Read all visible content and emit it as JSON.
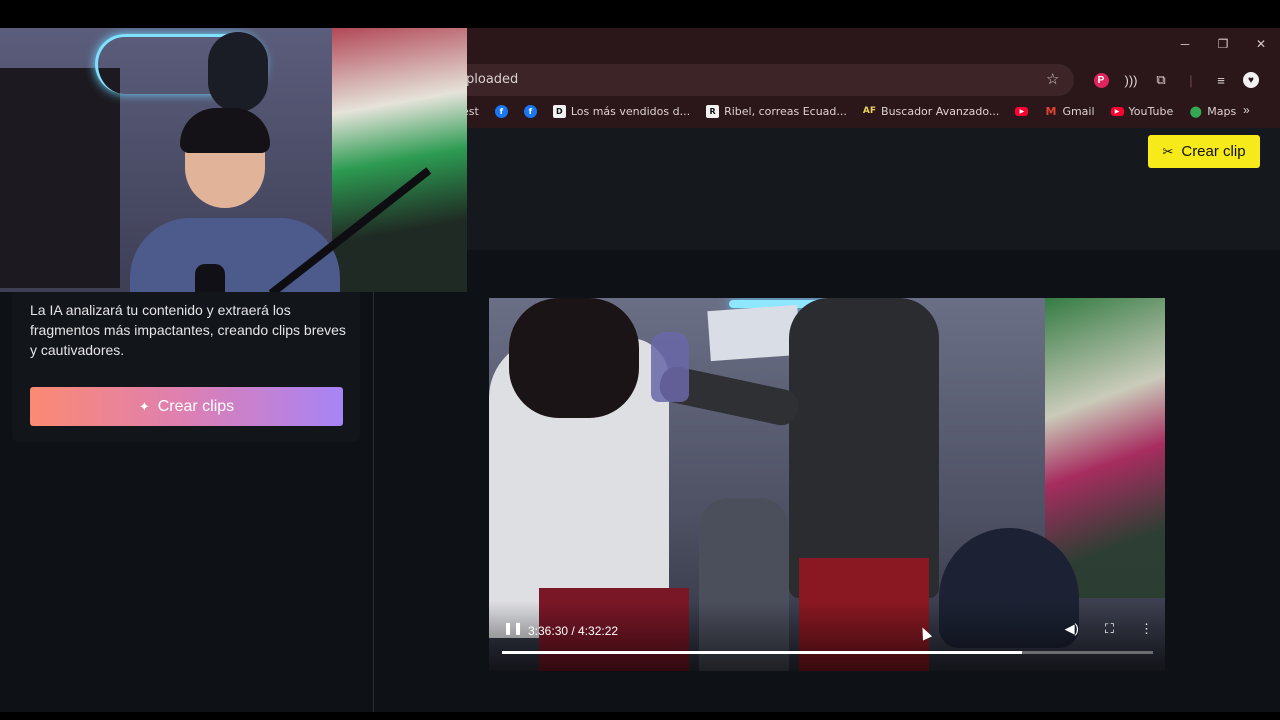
{
  "browser": {
    "url_text": "ploaded",
    "window_controls": [
      "─",
      "❐",
      "✕"
    ],
    "bookmarks": [
      {
        "label": "est",
        "icon": "none"
      },
      {
        "label": "",
        "icon": "facebook-icon"
      },
      {
        "label": "",
        "icon": "facebook-icon"
      },
      {
        "label": "Los más vendidos d...",
        "icon": "d-icon"
      },
      {
        "label": "Ribel, correas Ecuad...",
        "icon": "r-icon"
      },
      {
        "label": "Buscador Avanzado...",
        "icon": "af-icon"
      },
      {
        "label": "",
        "icon": "youtube-icon"
      },
      {
        "label": "Gmail",
        "icon": "gmail-icon"
      },
      {
        "label": "YouTube",
        "icon": "youtube-icon"
      },
      {
        "label": "Maps",
        "icon": "maps-icon"
      }
    ],
    "bookmarks_more": "»"
  },
  "header": {
    "crear_clip_label": "Crear clip"
  },
  "left_panel": {
    "description": "La IA analizará tu contenido y extraerá los fragmentos más impactantes, creando clips breves y cautivadores.",
    "button_label": "Crear clips"
  },
  "player": {
    "time": "3:36:30 / 4:32:22",
    "progress": 0.7985
  },
  "colors": {
    "accent_yellow": "#f7ea1b",
    "gradient_start": "#fb8a73",
    "gradient_end": "#a784f6",
    "page_bg": "#0e1116",
    "chrome_bg": "#2b1719"
  }
}
